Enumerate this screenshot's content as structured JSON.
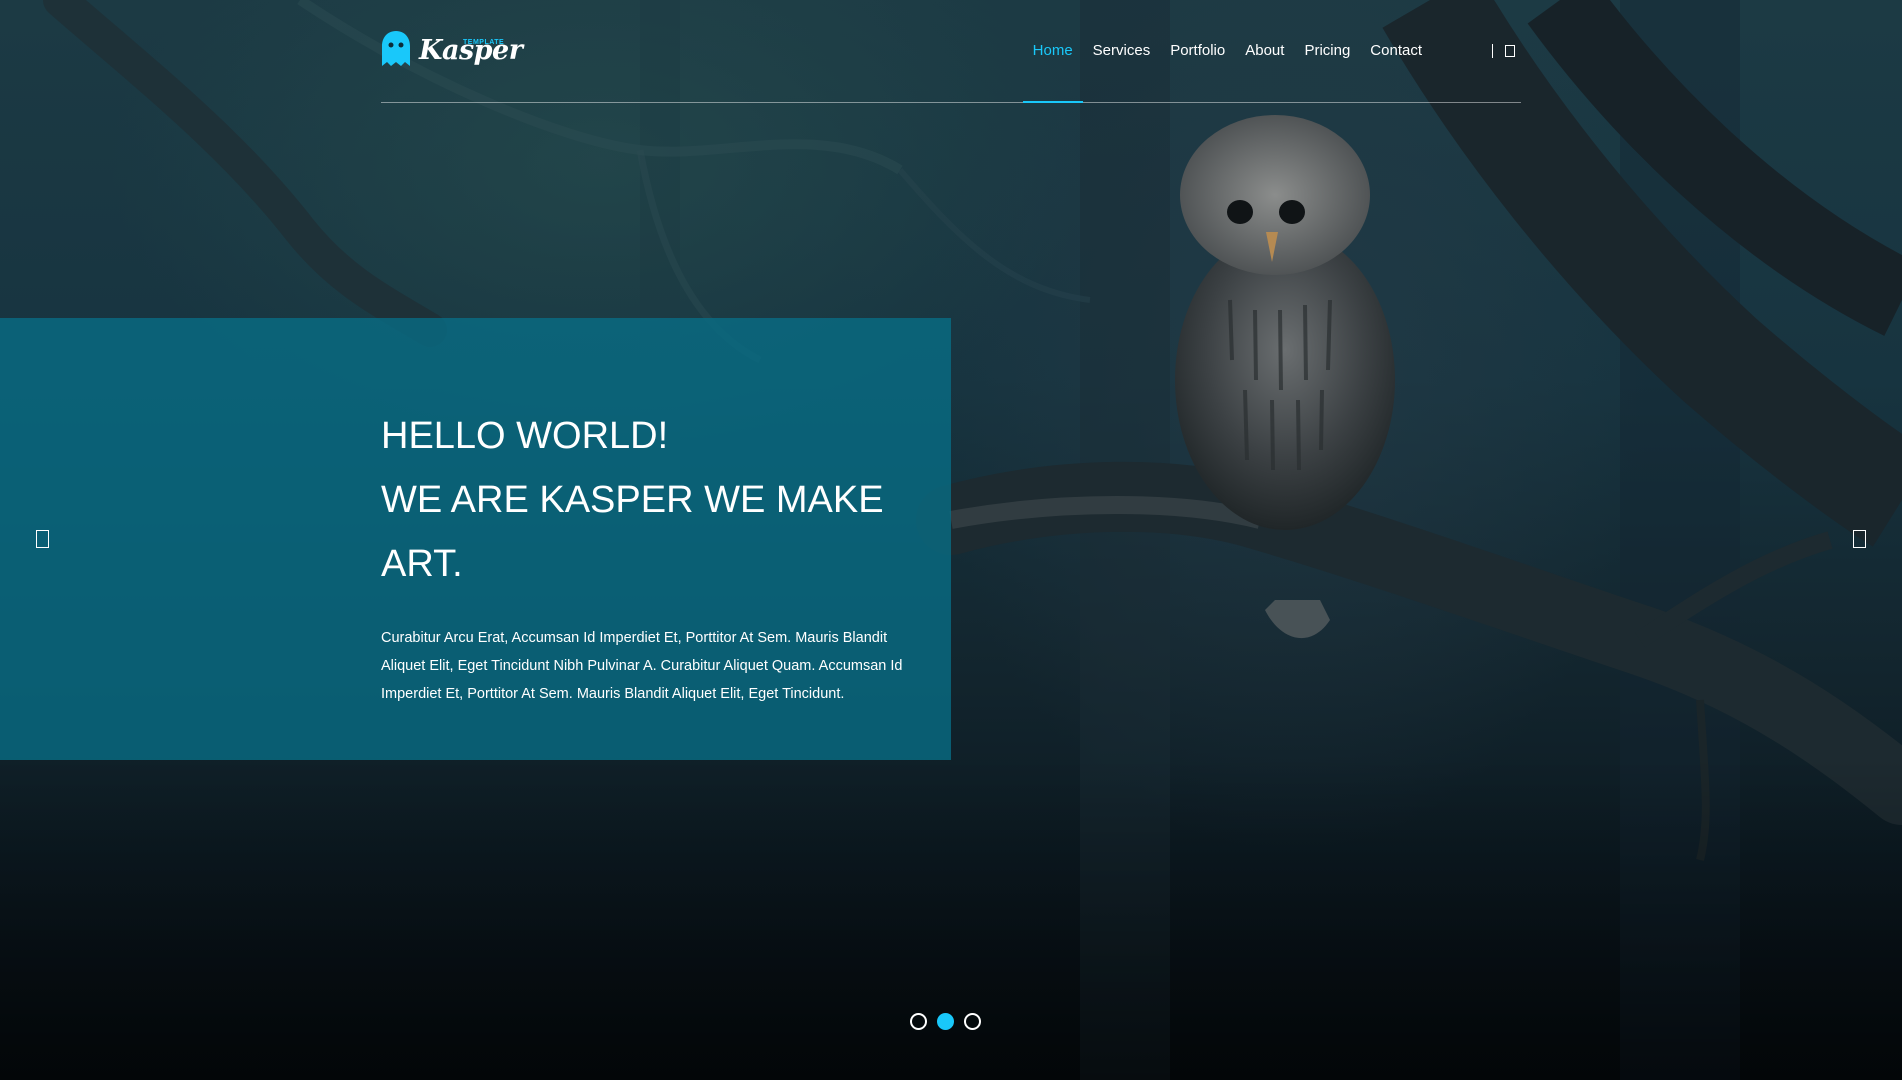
{
  "brand": {
    "name": "Kasper",
    "tag": "TEMPLATE",
    "accent": "#19c8fa"
  },
  "nav": {
    "items": [
      {
        "label": "Home",
        "active": true
      },
      {
        "label": "Services",
        "active": false
      },
      {
        "label": "Portfolio",
        "active": false
      },
      {
        "label": "About",
        "active": false
      },
      {
        "label": "Pricing",
        "active": false
      },
      {
        "label": "Contact",
        "active": false
      }
    ],
    "search_icon": "search-icon"
  },
  "hero": {
    "heading_lines": [
      "HELLO WORLD!",
      "WE ARE KASPER WE MAKE",
      "ART."
    ],
    "description": "Curabitur Arcu Erat, Accumsan Id Imperdiet Et, Porttitor At Sem. Mauris Blandit Aliquet Elit, Eget Tincidunt Nibh Pulvinar A. Curabitur Aliquet Quam. Accumsan Id Imperdiet Et, Porttitor At Sem. Mauris Blandit Aliquet Elit, Eget Tincidunt.",
    "panel_color": "#086e87"
  },
  "slider": {
    "prev_icon": "chevron-left-icon",
    "next_icon": "chevron-right-icon",
    "slide_count": 3,
    "active_index": 1
  }
}
